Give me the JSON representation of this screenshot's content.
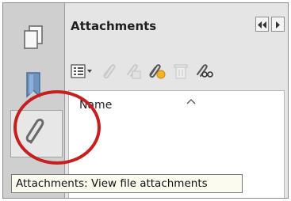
{
  "navigation": {
    "items": [
      {
        "name": "pages",
        "icon": "page-thumbnails-icon"
      },
      {
        "name": "bookmarks",
        "icon": "bookmark-icon"
      },
      {
        "name": "attachments",
        "icon": "paperclip-icon",
        "active": true
      }
    ]
  },
  "panel": {
    "title": "Attachments",
    "controls": [
      "collapse-panel-icon",
      "expand-panel-icon"
    ]
  },
  "toolbar": {
    "buttons": [
      {
        "name": "options-menu",
        "icon": "list-options-icon",
        "enabled": true
      },
      {
        "name": "open-attachment",
        "icon": "open-attachment-icon",
        "enabled": false
      },
      {
        "name": "save-attachment",
        "icon": "save-attachment-icon",
        "enabled": false
      },
      {
        "name": "add-attachment",
        "icon": "add-attachment-icon",
        "enabled": true
      },
      {
        "name": "delete-attachment",
        "icon": "trash-icon",
        "enabled": false
      },
      {
        "name": "search-attachments",
        "icon": "search-attachment-icon",
        "enabled": true
      }
    ]
  },
  "list": {
    "column_header": "Name",
    "sort_icon": "sort-ascending-icon",
    "items": []
  },
  "tooltip": {
    "text": "Attachments: View file attachments"
  },
  "annotation": {
    "color": "#c51f1f",
    "shape": "circle highlight around attachments button"
  },
  "colors": {
    "nav_background": "#cfcfcf",
    "panel_background": "#e5e5e5",
    "tooltip_background": "#fbfbf0"
  }
}
